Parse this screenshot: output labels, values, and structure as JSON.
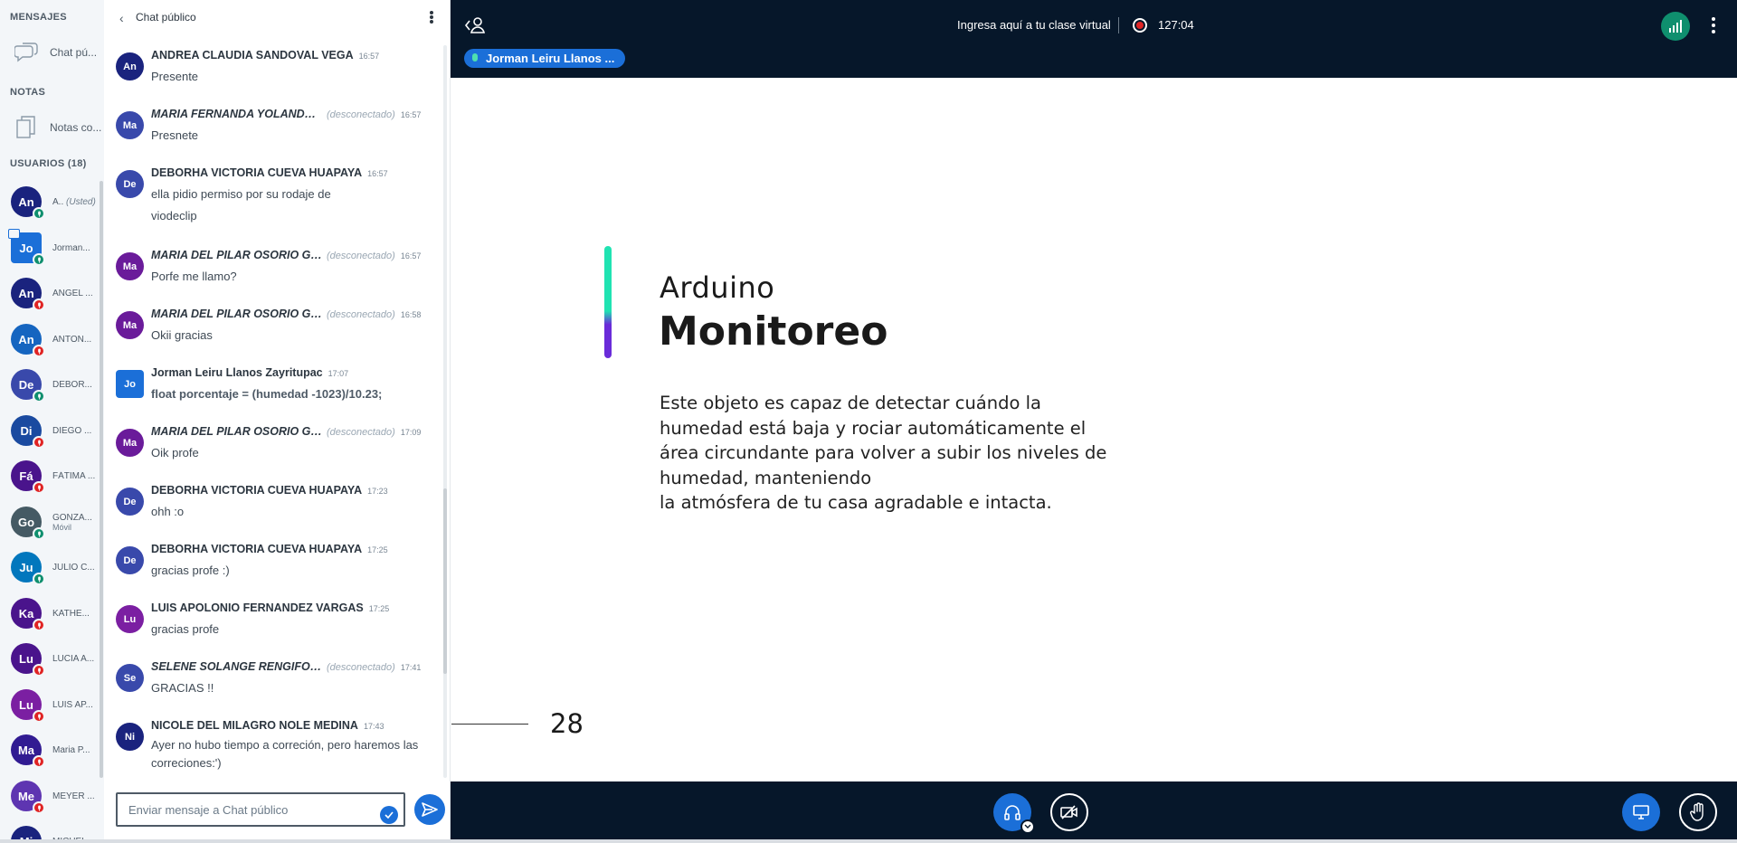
{
  "sidebar": {
    "messages_title": "MENSAJES",
    "public_chat_label": "Chat pú...",
    "notes_title": "NOTAS",
    "notes_label": "Notas co...",
    "users_title": "USUARIOS (18)",
    "users": [
      {
        "initials": "An",
        "name": "A..",
        "tag": "(Usted)",
        "color": "#1a237e",
        "status": "on"
      },
      {
        "initials": "Jo",
        "name": "Jorman...",
        "color": "#1b6fd8",
        "status": "on"
      },
      {
        "initials": "An",
        "name": "ANGEL ...",
        "color": "#1a237e",
        "status": "off"
      },
      {
        "initials": "An",
        "name": "ANTON...",
        "color": "#1565c0",
        "status": "off"
      },
      {
        "initials": "De",
        "name": "DEBOR...",
        "color": "#3949ab",
        "status": "on"
      },
      {
        "initials": "Di",
        "name": "DIEGO ...",
        "color": "#1a4aa0",
        "status": "off"
      },
      {
        "initials": "Fá",
        "name": "FÁTIMA ...",
        "color": "#4a148c",
        "status": "off"
      },
      {
        "initials": "Go",
        "name": "GONZA...",
        "sub": "Móvil",
        "color": "#455a64",
        "status": "on"
      },
      {
        "initials": "Ju",
        "name": "JULIO C...",
        "color": "#0277bd",
        "status": "on"
      },
      {
        "initials": "Ka",
        "name": "KATHE...",
        "color": "#4a148c",
        "status": "off"
      },
      {
        "initials": "Lu",
        "name": "LUCIA A...",
        "color": "#4a148c",
        "status": "off"
      },
      {
        "initials": "Lu",
        "name": "LUIS AP...",
        "color": "#7b1fa2",
        "status": "off"
      },
      {
        "initials": "Ma",
        "name": "Maria P...",
        "color": "#311b92",
        "status": "off"
      },
      {
        "initials": "Me",
        "name": "MEYER ...",
        "color": "#5e35b1",
        "status": "off"
      },
      {
        "initials": "Mi",
        "name": "MICHEL...",
        "color": "#1a237e",
        "status": "off"
      }
    ]
  },
  "chat": {
    "title": "Chat público",
    "disconnected_label": "(desconectado)",
    "input_placeholder": "Enviar mensaje a Chat público",
    "messages": [
      {
        "initials": "An",
        "color": "#1a237e",
        "name": "ANDREA CLAUDIA SANDOVAL VEGA",
        "time": "16:57",
        "text": "Presente",
        "offline": false
      },
      {
        "initials": "Ma",
        "color": "#3949ab",
        "name": "MARIA FERNANDA YOLANDA T...",
        "time": "16:57",
        "text": "Presnete",
        "offline": true
      },
      {
        "initials": "De",
        "color": "#3949ab",
        "name": "DEBORHA VICTORIA CUEVA HUAPAYA",
        "time": "16:57",
        "text": "ella pidio permiso por su rodaje de viodeclip",
        "offline": false
      },
      {
        "initials": "Ma",
        "color": "#6a1b9a",
        "name": "MARIA DEL PILAR OSORIO GAL...",
        "time": "16:57",
        "text": "Porfe me llamo?",
        "offline": true
      },
      {
        "initials": "Ma",
        "color": "#6a1b9a",
        "name": "MARIA DEL PILAR OSORIO GAL...",
        "time": "16:58",
        "text": "Okii gracias",
        "offline": true
      },
      {
        "initials": "Jo",
        "color": "#1b6fd8",
        "name": "Jorman Leiru Llanos Zayritupac",
        "time": "17:07",
        "text": "float porcentaje = (humedad -1023)/10.23;",
        "offline": false
      },
      {
        "initials": "Ma",
        "color": "#6a1b9a",
        "name": "MARIA DEL PILAR OSORIO GAL...",
        "time": "17:09",
        "text": "Oik profe",
        "offline": true
      },
      {
        "initials": "De",
        "color": "#3949ab",
        "name": "DEBORHA VICTORIA CUEVA HUAPAYA",
        "time": "17:23",
        "text": "ohh :o",
        "offline": false
      },
      {
        "initials": "De",
        "color": "#3949ab",
        "name": "DEBORHA VICTORIA CUEVA HUAPAYA",
        "time": "17:25",
        "text": "gracias profe :)",
        "offline": false
      },
      {
        "initials": "Lu",
        "color": "#7b1fa2",
        "name": "LUIS APOLONIO FERNANDEZ VARGAS",
        "time": "17:25",
        "text": "gracias profe",
        "offline": false
      },
      {
        "initials": "Se",
        "color": "#3949ab",
        "name": "SELENE SOLANGE RENGIFO R...",
        "time": "17:41",
        "text": "GRACIAS !!",
        "offline": true
      },
      {
        "initials": "Ni",
        "color": "#1a237e",
        "name": "NICOLE DEL MILAGRO NOLE MEDINA",
        "time": "17:43",
        "text": "Ayer no hubo tiempo a correción, pero haremos las correciones:')",
        "offline": false
      }
    ]
  },
  "navbar": {
    "meeting_title": "Ingresa aquí a tu clase virtual",
    "recording_time": "127:04",
    "talking_user": "Jorman Leiru Llanos ..."
  },
  "slide": {
    "subtitle": "Arduino",
    "title": "Monitoreo",
    "body_lines": [
      "Este objeto es capaz de detectar cuándo la",
      "humedad está baja y rociar automáticamente el",
      "área circundante para volver a subir los niveles de",
      "humedad, manteniendo",
      "la atmósfera de tu casa agradable e intacta."
    ],
    "page_number": "28"
  },
  "colors": {
    "navbar_bg": "#06172a",
    "primary_blue": "#1b6fd8",
    "connection_green": "#0f8f6e",
    "muted_red": "#e02424",
    "accent_teal": "#20e3b2",
    "accent_purple": "#6a2bd9"
  },
  "icons": {
    "public_chat": "chat-bubble-icon",
    "notes": "notes-icon",
    "leave": "user-back-icon",
    "record": "record-icon",
    "connection": "signal-bars-icon",
    "audio": "headphones-icon",
    "video": "video-off-icon",
    "screen": "screen-share-icon",
    "hand": "raise-hand-icon",
    "send": "send-icon"
  }
}
